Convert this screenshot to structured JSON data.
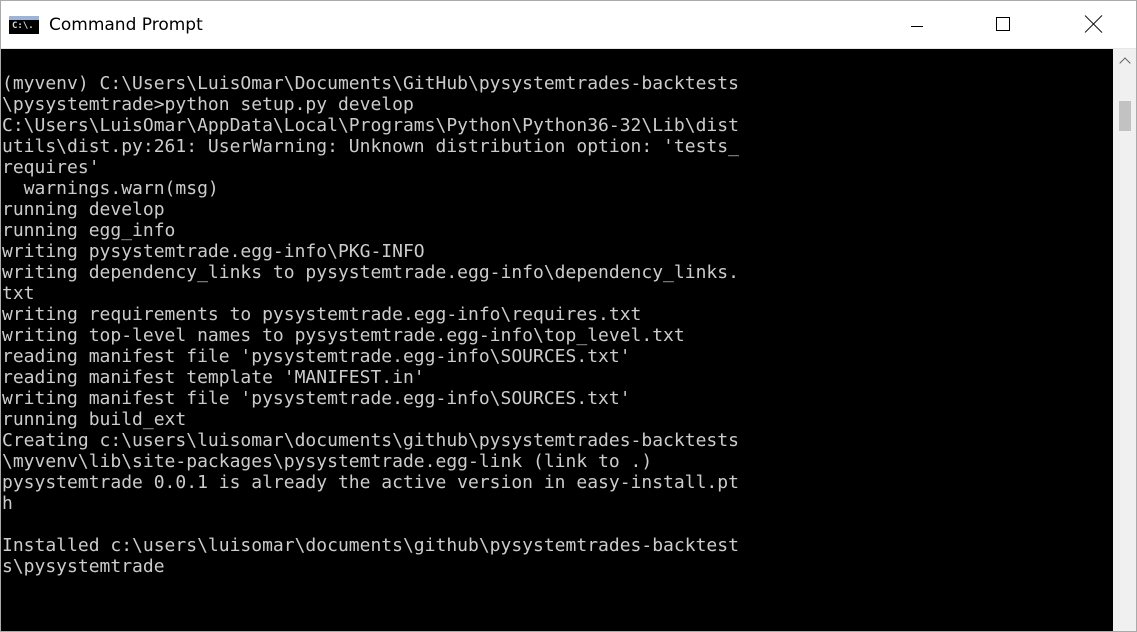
{
  "window": {
    "title": "Command Prompt",
    "icon": "cmd-icon",
    "icon_glyph": "C:\\.",
    "controls": {
      "minimize": "minimize-icon",
      "maximize": "maximize-icon",
      "close": "close-icon"
    }
  },
  "console": {
    "background": "#000000",
    "foreground": "#cccccc",
    "lines": [
      "",
      "(myvenv) C:\\Users\\LuisOmar\\Documents\\GitHub\\pysystemtrades-backtests",
      "\\pysystemtrade>python setup.py develop",
      "C:\\Users\\LuisOmar\\AppData\\Local\\Programs\\Python\\Python36-32\\Lib\\dist",
      "utils\\dist.py:261: UserWarning: Unknown distribution option: 'tests_",
      "requires'",
      "  warnings.warn(msg)",
      "running develop",
      "running egg_info",
      "writing pysystemtrade.egg-info\\PKG-INFO",
      "writing dependency_links to pysystemtrade.egg-info\\dependency_links.",
      "txt",
      "writing requirements to pysystemtrade.egg-info\\requires.txt",
      "writing top-level names to pysystemtrade.egg-info\\top_level.txt",
      "reading manifest file 'pysystemtrade.egg-info\\SOURCES.txt'",
      "reading manifest template 'MANIFEST.in'",
      "writing manifest file 'pysystemtrade.egg-info\\SOURCES.txt'",
      "running build_ext",
      "Creating c:\\users\\luisomar\\documents\\github\\pysystemtrades-backtests",
      "\\myvenv\\lib\\site-packages\\pysystemtrade.egg-link (link to .)",
      "pysystemtrade 0.0.1 is already the active version in easy-install.pt",
      "h",
      "",
      "Installed c:\\users\\luisomar\\documents\\github\\pysystemtrades-backtest",
      "s\\pysystemtrade"
    ]
  },
  "scrollbar": {
    "up_arrow": "chevron-up-icon"
  }
}
